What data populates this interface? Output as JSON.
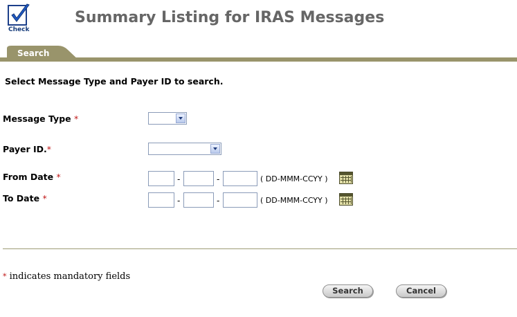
{
  "header": {
    "logo_text": "Check",
    "title": "Summary Listing for IRAS Messages"
  },
  "tabs": [
    {
      "label": "Search"
    }
  ],
  "instruction": "Select Message Type and Payer ID to search.",
  "form": {
    "message_type_label": "Message Type",
    "payer_id_label": "Payer ID.",
    "from_date_label": "From Date",
    "to_date_label": "To Date",
    "required_mark": "*",
    "date_separator": "-",
    "date_format_hint": "( DD-MMM-CCYY )",
    "message_type_value": "",
    "payer_id_value": "",
    "from_date": {
      "day": "",
      "month": "",
      "year": ""
    },
    "to_date": {
      "day": "",
      "month": "",
      "year": ""
    }
  },
  "footer": {
    "mandatory_mark": "*",
    "mandatory_note": " indicates mandatory fields"
  },
  "buttons": {
    "search": "Search",
    "cancel": "Cancel"
  },
  "icons": {
    "logo": "checkmark-logo-icon",
    "calendar": "calendar-icon",
    "dropdown": "chevron-down-icon"
  }
}
